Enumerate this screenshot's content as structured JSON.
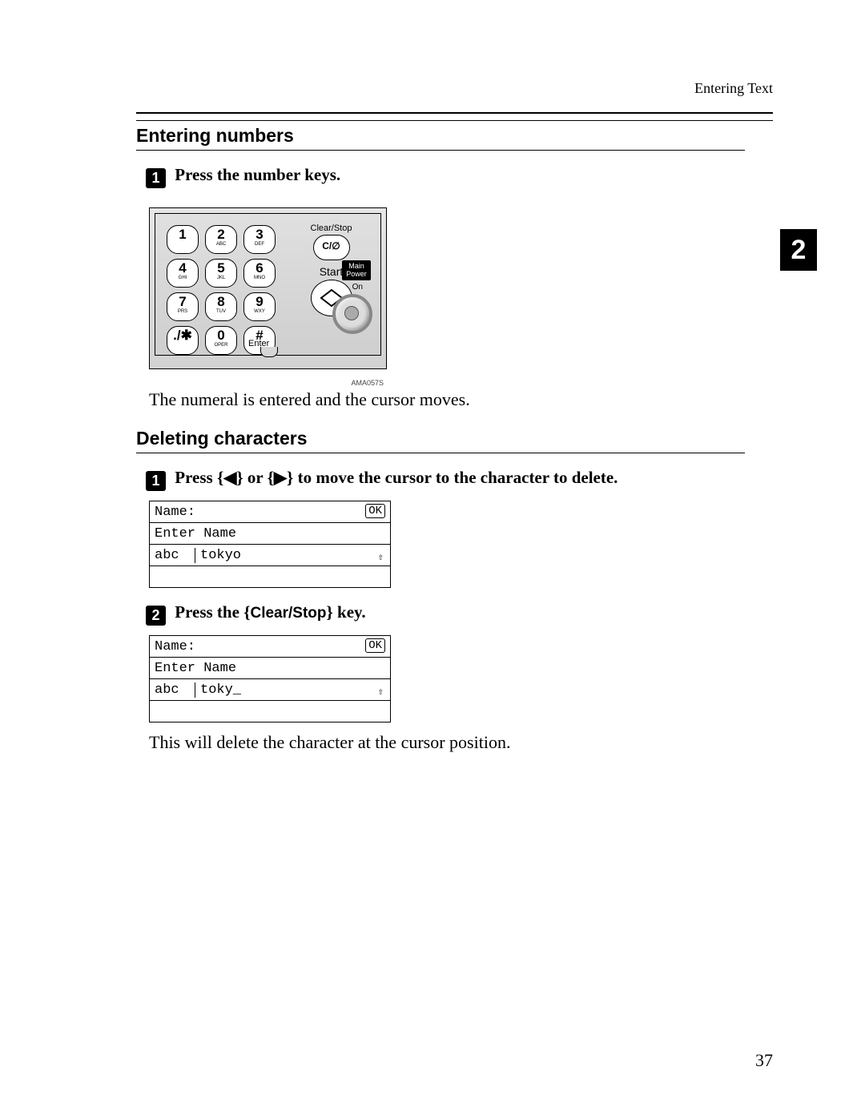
{
  "running_head": "Entering Text",
  "chapter_tab": "2",
  "section1": {
    "title": "Entering numbers",
    "step1": "Press the number keys.",
    "keypad": {
      "keys": [
        {
          "big": "1",
          "sub": ""
        },
        {
          "big": "2",
          "sub": "ABC"
        },
        {
          "big": "3",
          "sub": "DEF"
        },
        {
          "big": "4",
          "sub": "GHI"
        },
        {
          "big": "5",
          "sub": "JKL"
        },
        {
          "big": "6",
          "sub": "MNO"
        },
        {
          "big": "7",
          "sub": "PRS"
        },
        {
          "big": "8",
          "sub": "TUV"
        },
        {
          "big": "9",
          "sub": "WXY"
        },
        {
          "big": "./✱",
          "sub": ""
        },
        {
          "big": "0",
          "sub": "OPER"
        },
        {
          "big": "#",
          "sub": ""
        }
      ],
      "enter_label": "Enter",
      "clearstop_label": "Clear/Stop",
      "clearstop_btn": "C/∅",
      "start_label": "Start",
      "main_power": "Main\nPower",
      "on_label": "On",
      "fig_code": "AMA057S"
    },
    "result": "The numeral is entered and the cursor moves."
  },
  "section2": {
    "title": "Deleting characters",
    "step1_pre": "Press ",
    "step1_or": " or ",
    "step1_post": " to move the cursor to the character to delete.",
    "lcd1": {
      "row1": "Name:",
      "ok": "OK",
      "row2": "Enter Name",
      "mode": "abc",
      "value": "tokyo",
      "shift": "⇧"
    },
    "step2_pre": "Press the ",
    "step2_key": "Clear/Stop",
    "step2_post": " key.",
    "lcd2": {
      "row1": "Name:",
      "ok": "OK",
      "row2": "Enter Name",
      "mode": "abc",
      "value": "toky_",
      "shift": "⇧"
    },
    "result": "This will delete the character at the cursor position."
  },
  "page_number": "37",
  "arrows": {
    "left": "◀",
    "right": "▶"
  }
}
